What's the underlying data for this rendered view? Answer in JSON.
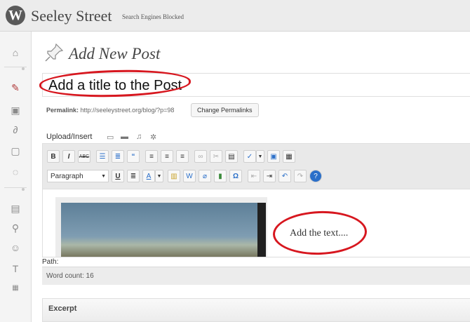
{
  "header": {
    "logo_letter": "W",
    "site_title": "Seeley Street",
    "site_status": "Search Engines Blocked"
  },
  "page": {
    "title": "Add New Post"
  },
  "post": {
    "title_value": "Add a title to the Post",
    "permalink_label": "Permalink:",
    "permalink_url": "http://seeleystreet.org/blog/?p=98",
    "change_permalink_label": "Change Permalinks"
  },
  "upload": {
    "label": "Upload/Insert"
  },
  "editor": {
    "format_value": "Paragraph",
    "content_text": "Add the text....",
    "path_label": "Path:",
    "word_count": "Word count: 16"
  },
  "excerpt": {
    "label": "Excerpt"
  },
  "colors": {
    "annotation": "#d7171f",
    "topbar": "#ececec",
    "accent_blue": "#2a6fc9"
  }
}
